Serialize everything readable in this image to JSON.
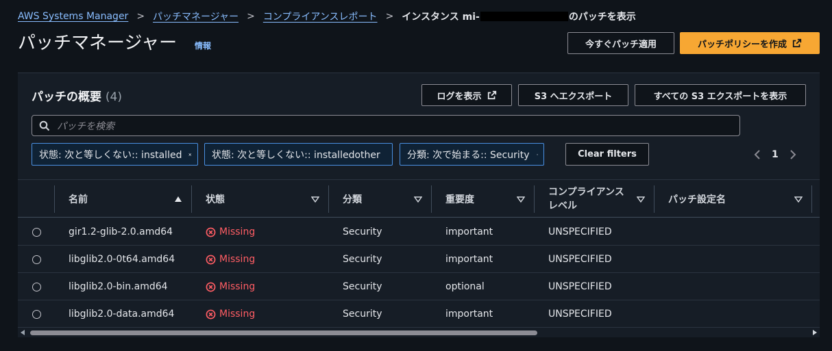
{
  "breadcrumb": {
    "items": [
      "AWS Systems Manager",
      "パッチマネージャー",
      "コンプライアンスレポート"
    ],
    "current_prefix": "インスタンス mi-",
    "current_suffix": "のパッチを表示"
  },
  "header": {
    "title": "パッチマネージャー",
    "info": "情報",
    "apply_now": "今すぐパッチ適用",
    "create_policy": "パッチポリシーを作成"
  },
  "panel": {
    "title": "パッチの概要",
    "count": "(4)",
    "view_logs": "ログを表示",
    "export_s3": "S3 へエクスポート",
    "view_all_exports": "すべての S3 エクスポートを表示",
    "search_placeholder": "パッチを検索",
    "filters": [
      {
        "label": "状態: 次と等しくない:: installed"
      },
      {
        "label": "状態: 次と等しくない:: installedother"
      },
      {
        "label": "分類: 次で始まる:: Security"
      }
    ],
    "clear_filters": "Clear filters",
    "page": "1"
  },
  "table": {
    "columns": {
      "name": "名前",
      "state": "状態",
      "classification": "分類",
      "severity": "重要度",
      "compliance_1": "コンプライアンス",
      "compliance_2": "レベル",
      "patch_set": "パッチ設定名"
    },
    "rows": [
      {
        "name": "gir1.2-glib-2.0.amd64",
        "state": "Missing",
        "classification": "Security",
        "severity": "important",
        "compliance": "UNSPECIFIED",
        "patch_set": ""
      },
      {
        "name": "libglib2.0-0t64.amd64",
        "state": "Missing",
        "classification": "Security",
        "severity": "important",
        "compliance": "UNSPECIFIED",
        "patch_set": ""
      },
      {
        "name": "libglib2.0-bin.amd64",
        "state": "Missing",
        "classification": "Security",
        "severity": "optional",
        "compliance": "UNSPECIFIED",
        "patch_set": ""
      },
      {
        "name": "libglib2.0-data.amd64",
        "state": "Missing",
        "classification": "Security",
        "severity": "important",
        "compliance": "UNSPECIFIED",
        "patch_set": ""
      }
    ]
  },
  "colors": {
    "accent": "#f7a733",
    "link": "#89bdff",
    "error": "#ff5d64",
    "filter_border": "#4a90e2"
  }
}
